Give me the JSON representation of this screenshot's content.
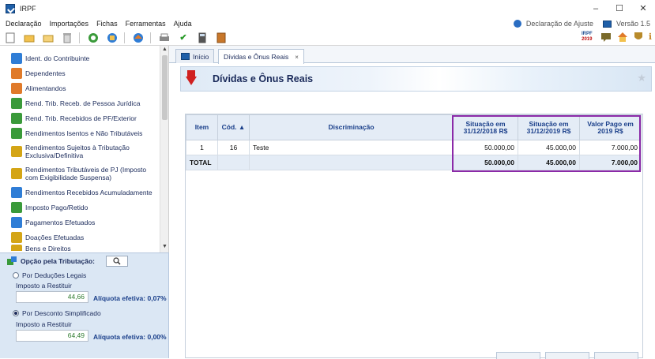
{
  "window": {
    "title": "IRPF",
    "minimize": "–",
    "maximize": "☐",
    "close": "✕"
  },
  "menu": {
    "items": [
      "Declaração",
      "Importações",
      "Fichas",
      "Ferramentas",
      "Ajuda"
    ],
    "declaracao_ajuste": "Declaração de Ajuste",
    "versao": "Versão 1.5"
  },
  "toolbar": {
    "irpf_badge_top": "IRPF",
    "irpf_badge_bottom": "2019"
  },
  "nav": {
    "items": [
      {
        "label": "Ident. do Contribuinte",
        "color": "#2f7dd6"
      },
      {
        "label": "Dependentes",
        "color": "#e07a2a"
      },
      {
        "label": "Alimentandos",
        "color": "#e07a2a"
      },
      {
        "label": "Rend. Trib. Receb. de Pessoa Jurídica",
        "color": "#3a9a3a"
      },
      {
        "label": "Rend. Trib. Recebidos de PF/Exterior",
        "color": "#3a9a3a"
      },
      {
        "label": "Rendimentos Isentos e Não Tributáveis",
        "color": "#3a9a3a"
      },
      {
        "label": "Rendimentos Sujeitos à Tributação Exclusiva/Definitiva",
        "color": "#d4a516"
      },
      {
        "label": "Rendimentos Tributáveis de PJ (Imposto com Exigibilidade Suspensa)",
        "color": "#d4a516"
      },
      {
        "label": "Rendimentos Recebidos Acumuladamente",
        "color": "#2f7dd6"
      },
      {
        "label": "Imposto Pago/Retido",
        "color": "#3a9a3a"
      },
      {
        "label": "Pagamentos Efetuados",
        "color": "#2f7dd6"
      },
      {
        "label": "Doações Efetuadas",
        "color": "#d4a516"
      },
      {
        "label": "Bens e Direitos",
        "color": "#d4a516"
      }
    ]
  },
  "tributacao": {
    "header": "Opção pela Tributação:",
    "deducoes_label": "Por Deduções Legais",
    "deducoes_imposto_label": "Imposto a Restituir",
    "deducoes_value": "44,66",
    "deducoes_rate": "Alíquota efetiva: 0,07%",
    "simplificado_label": "Por Desconto Simplificado",
    "simplificado_imposto_label": "Imposto a Restituir",
    "simplificado_value": "64,49",
    "simplificado_rate": "Alíquota efetiva: 0,00%",
    "selected": "simplificado"
  },
  "tabs": [
    {
      "label": "Início"
    },
    {
      "label": "Dívidas e Ônus Reais",
      "close": "×"
    }
  ],
  "page": {
    "title": "Dívidas e Ônus Reais"
  },
  "grid": {
    "headers": {
      "item": "Item",
      "cod": "Cód. ▲",
      "discriminacao": "Discriminação",
      "sit2018": "Situação em 31/12/2018 R$",
      "sit2019": "Situação em 31/12/2019 R$",
      "valor_pago": "Valor Pago em 2019 R$"
    },
    "rows": [
      {
        "item": "1",
        "cod": "16",
        "discriminacao": "Teste",
        "sit2018": "50.000,00",
        "sit2019": "45.000,00",
        "valor_pago": "7.000,00"
      }
    ],
    "total": {
      "label": "TOTAL",
      "sit2018": "50.000,00",
      "sit2019": "45.000,00",
      "valor_pago": "7.000,00"
    }
  }
}
